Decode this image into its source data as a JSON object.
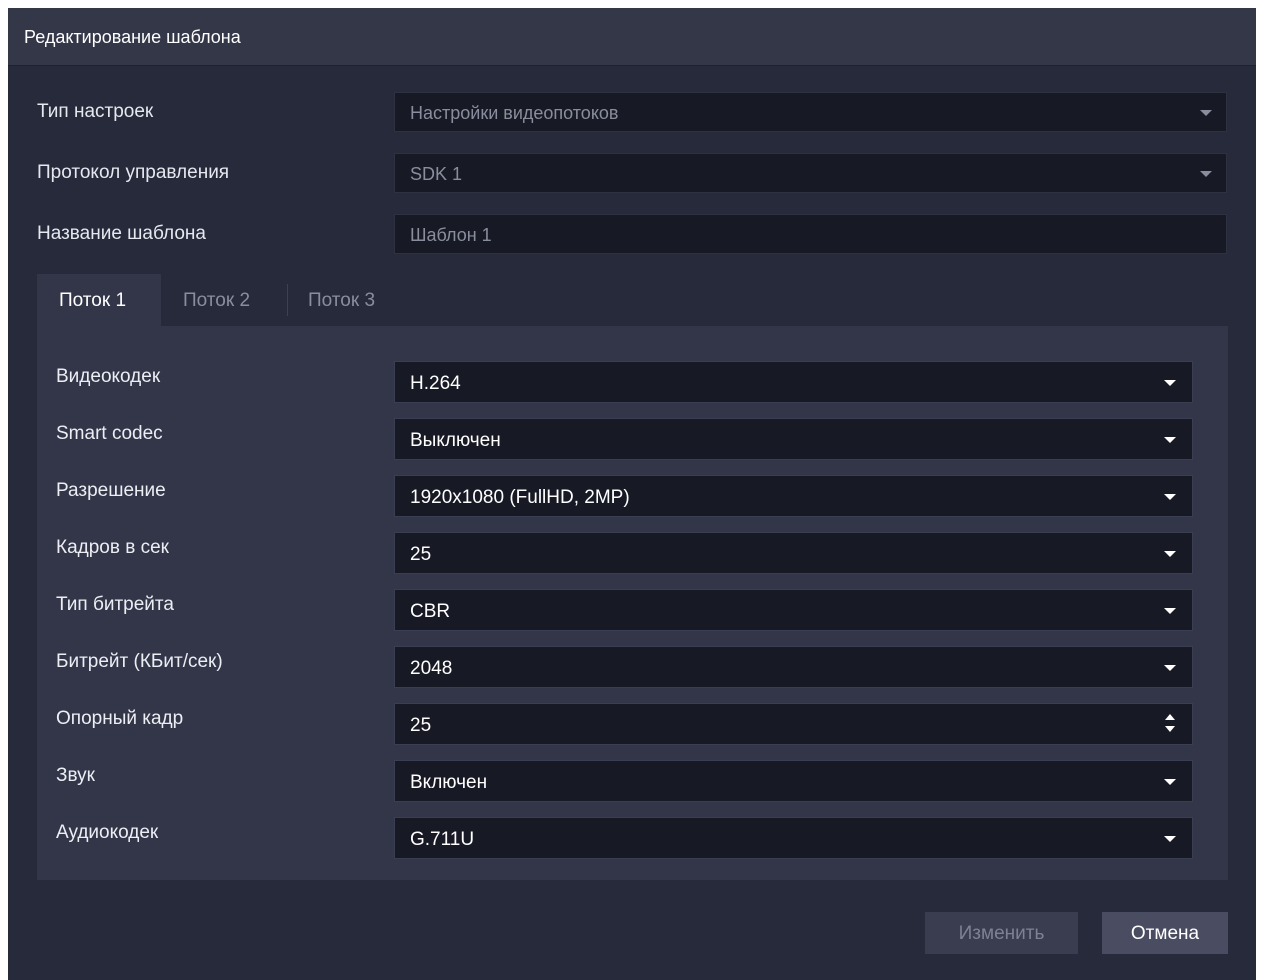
{
  "dialog": {
    "title": "Редактирование шаблона"
  },
  "settings_type": {
    "label": "Тип настроек",
    "value": "Настройки видеопотоков"
  },
  "protocol": {
    "label": "Протокол управления",
    "value": "SDK 1"
  },
  "template_name": {
    "label": "Название шаблона",
    "value": "Шаблон 1"
  },
  "tabs": [
    {
      "label": "Поток 1",
      "active": true
    },
    {
      "label": "Поток 2",
      "active": false
    },
    {
      "label": "Поток 3",
      "active": false
    }
  ],
  "stream": {
    "videocodec": {
      "label": "Видеокодек",
      "value": "H.264"
    },
    "smart_codec": {
      "label": "Smart codec",
      "value": "Выключен"
    },
    "resolution": {
      "label": "Разрешение",
      "value": "1920x1080 (FullHD, 2MP)"
    },
    "fps": {
      "label": "Кадров в сек",
      "value": "25"
    },
    "bitrate_type": {
      "label": "Тип битрейта",
      "value": "CBR"
    },
    "bitrate": {
      "label": "Битрейт (КБит/сек)",
      "value": "2048"
    },
    "keyframe": {
      "label": "Опорный кадр",
      "value": "25"
    },
    "sound": {
      "label": "Звук",
      "value": "Включен"
    },
    "audiocodec": {
      "label": "Аудиокодек",
      "value": "G.711U"
    }
  },
  "buttons": {
    "apply": "Изменить",
    "cancel": "Отмена"
  },
  "colors": {
    "dialog_bg": "#262a3b",
    "titlebar_bg": "#343748",
    "panel_bg": "#333649",
    "field_bg": "#171a25",
    "muted_text": "#8a8d9d"
  }
}
